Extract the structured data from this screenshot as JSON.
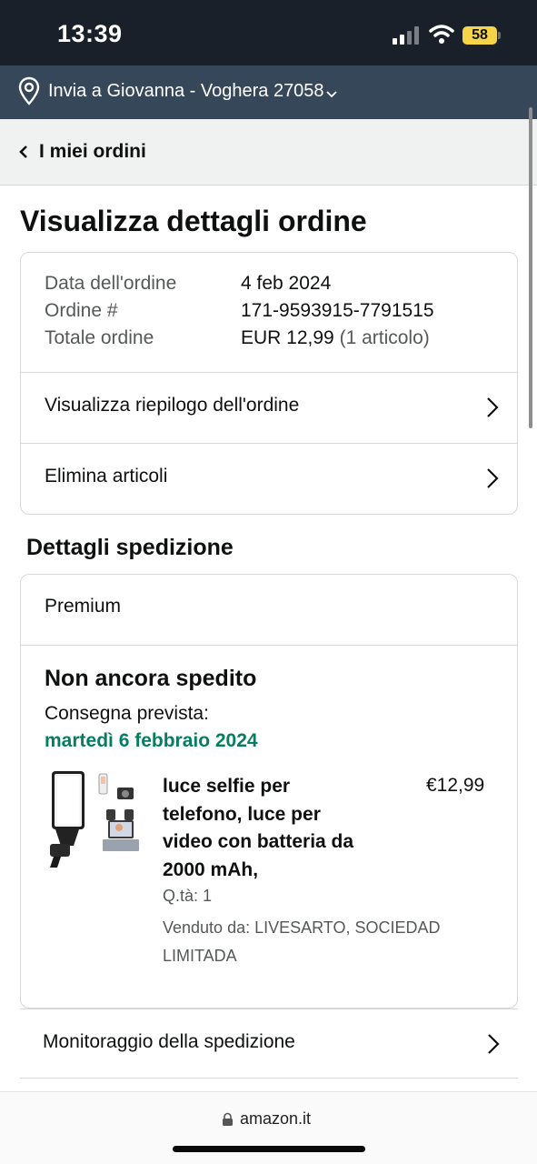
{
  "status_bar": {
    "time": "13:39",
    "battery_level": "58",
    "icons": [
      "cellular-signal-icon",
      "wifi-icon",
      "battery-icon"
    ]
  },
  "address_bar": {
    "text": "Invia a Giovanna - Voghera 27058",
    "icons": [
      "location-pin-icon",
      "chevron-down-icon"
    ]
  },
  "nav": {
    "back_label": "I miei ordini"
  },
  "page_title": "Visualizza dettagli ordine",
  "order_summary": {
    "rows": [
      {
        "label": "Data dell'ordine",
        "value": "4 feb 2024"
      },
      {
        "label": "Ordine #",
        "value": "171-9593915-7791515"
      },
      {
        "label": "Totale ordine",
        "value": "EUR 12,99",
        "value_note": "(1 articolo)"
      }
    ],
    "links": [
      {
        "label": "Visualizza riepilogo dell'ordine"
      },
      {
        "label": "Elimina articoli"
      }
    ]
  },
  "shipment": {
    "section_title": "Dettagli spedizione",
    "method": "Premium",
    "status": "Non ancora spedito",
    "delivery_label": "Consegna prevista:",
    "delivery_date": "martedì 6 febbraio 2024",
    "item": {
      "title_lines": [
        "luce selfie per",
        "telefono, luce per",
        "video con batteria da",
        "2000 mAh,"
      ],
      "price": "€12,99",
      "quantity": "Q.tà: 1",
      "seller_lines": [
        "Venduto da: LIVESARTO, SOCIEDAD",
        "LIMITADA"
      ]
    },
    "tracking_label": "Monitoraggio della spedizione"
  },
  "browser": {
    "url": "amazon.it"
  },
  "colors": {
    "status_bar_bg": "#19202a",
    "address_bar_bg": "#37475a",
    "delivery_green": "#067d62",
    "battery_yellow": "#f5d547"
  }
}
